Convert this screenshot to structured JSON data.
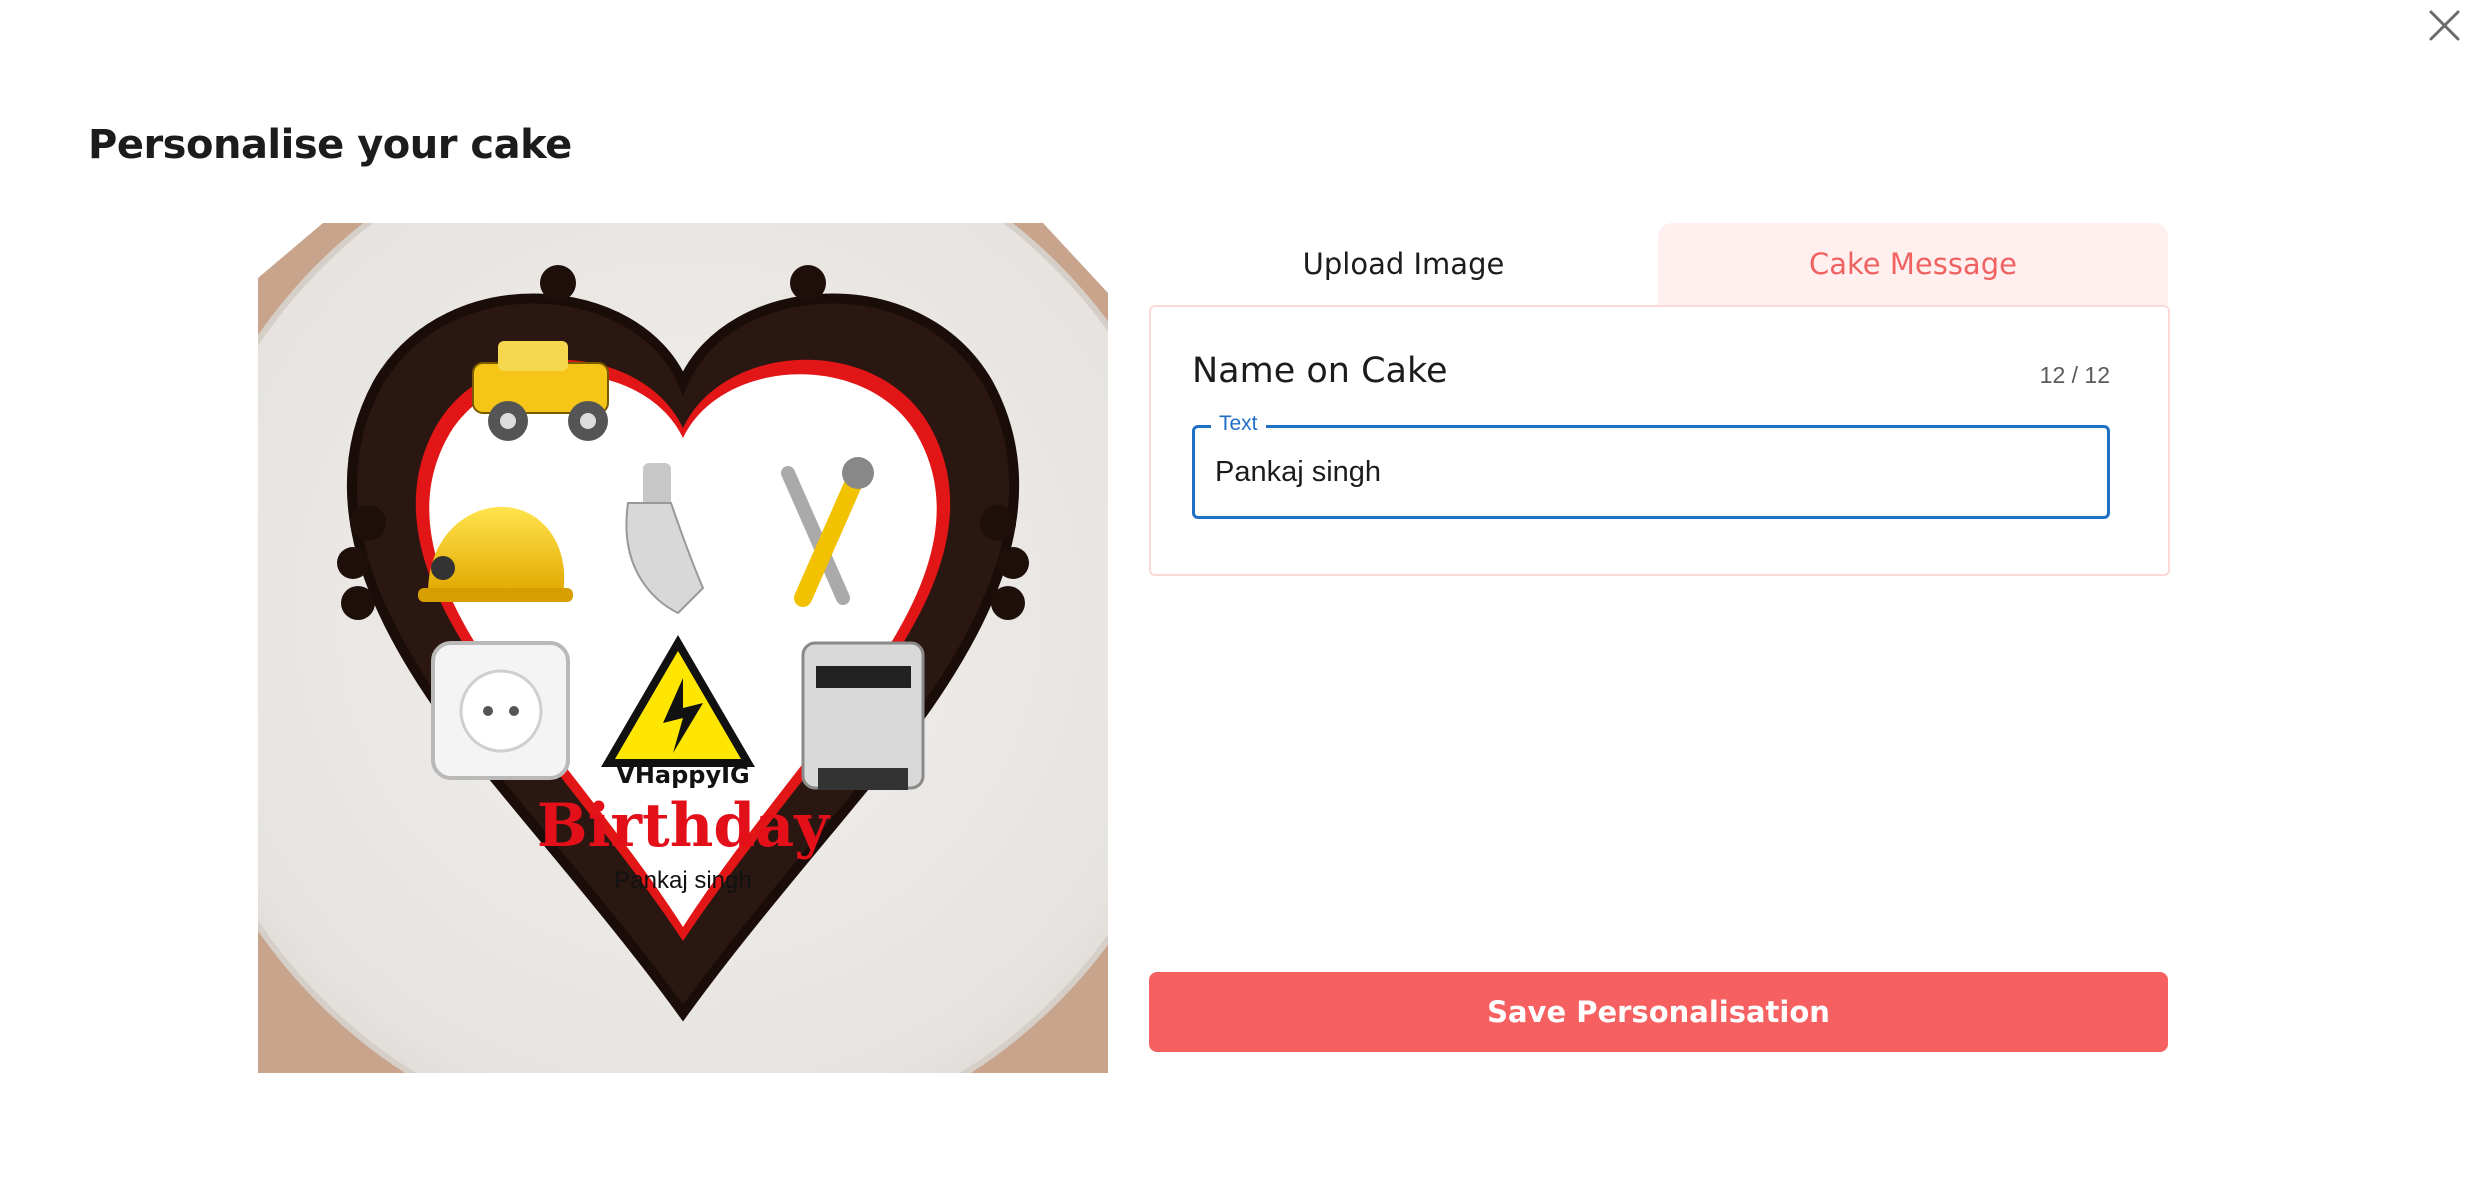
{
  "modal": {
    "title": "Personalise your cake"
  },
  "preview": {
    "icon": "heart-cake-preview",
    "cake_text": {
      "overlay_text": "VHappyIG",
      "greeting": "Birthday",
      "name": "Pankaj singh"
    }
  },
  "tabs": [
    {
      "label": "Upload Image",
      "active": false
    },
    {
      "label": "Cake Message",
      "active": true
    }
  ],
  "form": {
    "field_title": "Name on Cake",
    "counter": "12 / 12",
    "input_label": "Text",
    "input_value": "Pankaj singh"
  },
  "actions": {
    "save_label": "Save Personalisation"
  },
  "colors": {
    "accent": "#f66060",
    "tab_active_bg": "#fff0ef",
    "input_focus": "#1f6fc5",
    "chocolate": "#2b1712"
  }
}
